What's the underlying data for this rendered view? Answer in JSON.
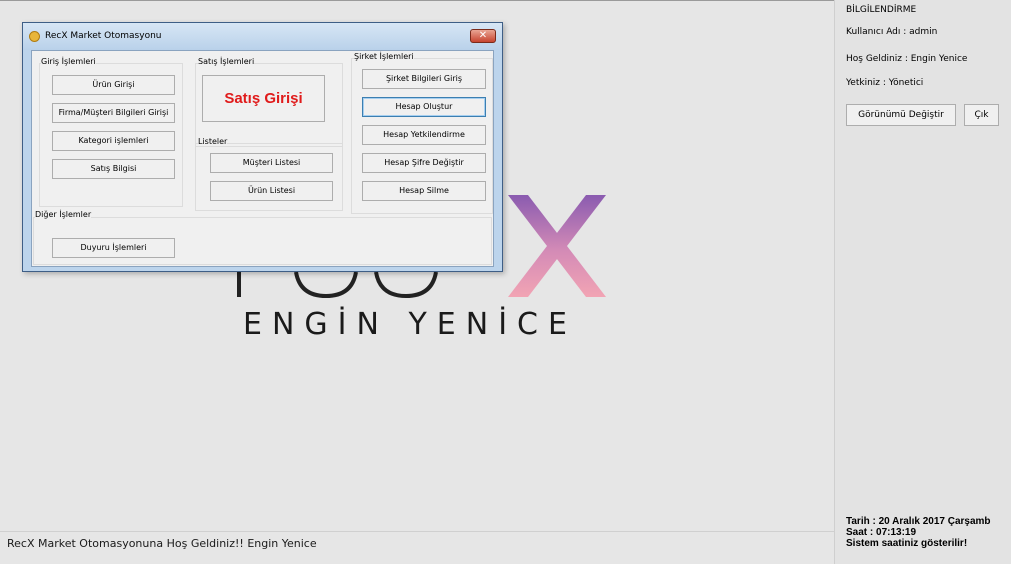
{
  "background": {
    "logo_text": "ENGİN YENİCE",
    "logo_partial_letters": "R O O"
  },
  "status_bar": {
    "text": "RecX Market Otomasyonuna Hoş Geldiniz!! Engin Yenice"
  },
  "right_panel": {
    "heading": "BİLGİLENDİRME",
    "user_label": "Kullanıcı Adı : admin",
    "welcome_label": "Hoş Geldiniz : Engin Yenice",
    "role_label": "Yetkiniz : Yönetici",
    "change_view_button": "Görünümü Değiştir",
    "exit_button": "Çık",
    "date_label": "Tarih : 20 Aralık 2017 Çarşamb",
    "time_label": "Saat  : 07:13:19",
    "system_note": "Sistem saatiniz gösterilir!"
  },
  "window": {
    "title": "RecX Market Otomasyonu",
    "close_label": "✕",
    "giris": {
      "label": "Giriş İşlemleri",
      "buttons": [
        "Ürün Girişi",
        "Firma/Müşteri Bilgileri Girişi",
        "Kategori işlemleri",
        "Satış Bilgisi"
      ]
    },
    "satis": {
      "label": "Satış İşlemleri",
      "button": "Satış Girişi"
    },
    "listeler": {
      "label": "Listeler",
      "buttons": [
        "Müşteri Listesi",
        "Ürün Listesi"
      ]
    },
    "sirket": {
      "label": "Şirket İşlemleri",
      "buttons": [
        "Şirket Bilgileri Giriş",
        "Hesap Oluştur",
        "Hesap Yetkilendirme",
        "Hesap Şifre Değiştir",
        "Hesap Silme"
      ]
    },
    "diger": {
      "label": "Diğer İşlemler",
      "button": "Duyuru İşlemleri"
    }
  }
}
